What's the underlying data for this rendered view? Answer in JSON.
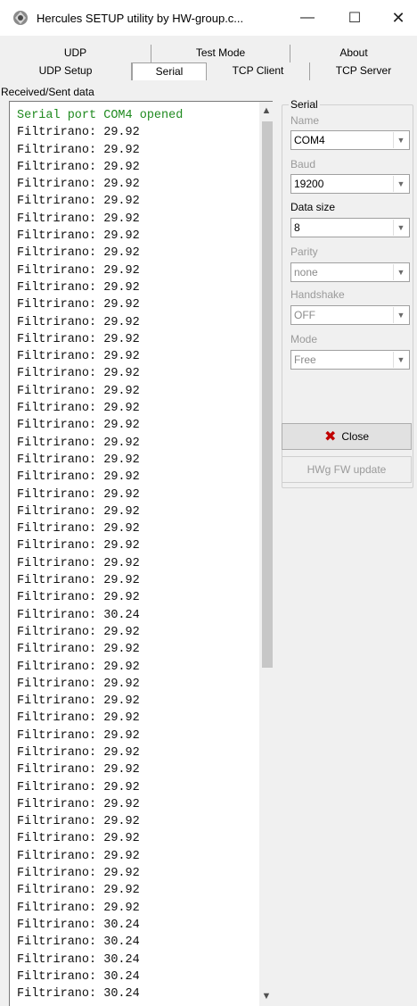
{
  "window": {
    "title": "Hercules SETUP utility by HW-group.c...",
    "controls": {
      "minimize": "—",
      "maximize": "☐",
      "close": "✕"
    }
  },
  "tabs_row1": [
    "UDP",
    "Test Mode",
    "About"
  ],
  "tabs_row2": [
    "UDP Setup",
    "Serial",
    "TCP Client",
    "TCP Server"
  ],
  "active_tab": "Serial",
  "received_label": "Received/Sent data",
  "log": {
    "lines": [
      "Serial port COM4 opened",
      "Filtrirano: 29.92",
      "Filtrirano: 29.92",
      "Filtrirano: 29.92",
      "Filtrirano: 29.92",
      "Filtrirano: 29.92",
      "Filtrirano: 29.92",
      "Filtrirano: 29.92",
      "Filtrirano: 29.92",
      "Filtrirano: 29.92",
      "Filtrirano: 29.92",
      "Filtrirano: 29.92",
      "Filtrirano: 29.92",
      "Filtrirano: 29.92",
      "Filtrirano: 29.92",
      "Filtrirano: 29.92",
      "Filtrirano: 29.92",
      "Filtrirano: 29.92",
      "Filtrirano: 29.92",
      "Filtrirano: 29.92",
      "Filtrirano: 29.92",
      "Filtrirano: 29.92",
      "Filtrirano: 29.92",
      "Filtrirano: 29.92",
      "Filtrirano: 29.92",
      "Filtrirano: 29.92",
      "Filtrirano: 29.92",
      "Filtrirano: 29.92",
      "Filtrirano: 29.92",
      "Filtrirano: 30.24",
      "Filtrirano: 29.92",
      "Filtrirano: 29.92",
      "Filtrirano: 29.92",
      "Filtrirano: 29.92",
      "Filtrirano: 29.92",
      "Filtrirano: 29.92",
      "Filtrirano: 29.92",
      "Filtrirano: 29.92",
      "Filtrirano: 29.92",
      "Filtrirano: 29.92",
      "Filtrirano: 29.92",
      "Filtrirano: 29.92",
      "Filtrirano: 29.92",
      "Filtrirano: 29.92",
      "Filtrirano: 29.92",
      "Filtrirano: 29.92",
      "Filtrirano: 29.92",
      "Filtrirano: 30.24",
      "Filtrirano: 30.24",
      "Filtrirano: 30.24",
      "Filtrirano: 30.24",
      "Filtrirano: 30.24"
    ],
    "highlight_color": "#1f8a1f"
  },
  "serial": {
    "group_title": "Serial",
    "name_label": "Name",
    "name_value": "COM4",
    "baud_label": "Baud",
    "baud_value": "19200",
    "datasize_label": "Data size",
    "datasize_value": "8",
    "parity_label": "Parity",
    "parity_value": "none",
    "handshake_label": "Handshake",
    "handshake_value": "OFF",
    "mode_label": "Mode",
    "mode_value": "Free",
    "close_button": "Close",
    "fw_button": "HWg FW update"
  },
  "colors": {
    "accent_close_x": "#c00000"
  }
}
